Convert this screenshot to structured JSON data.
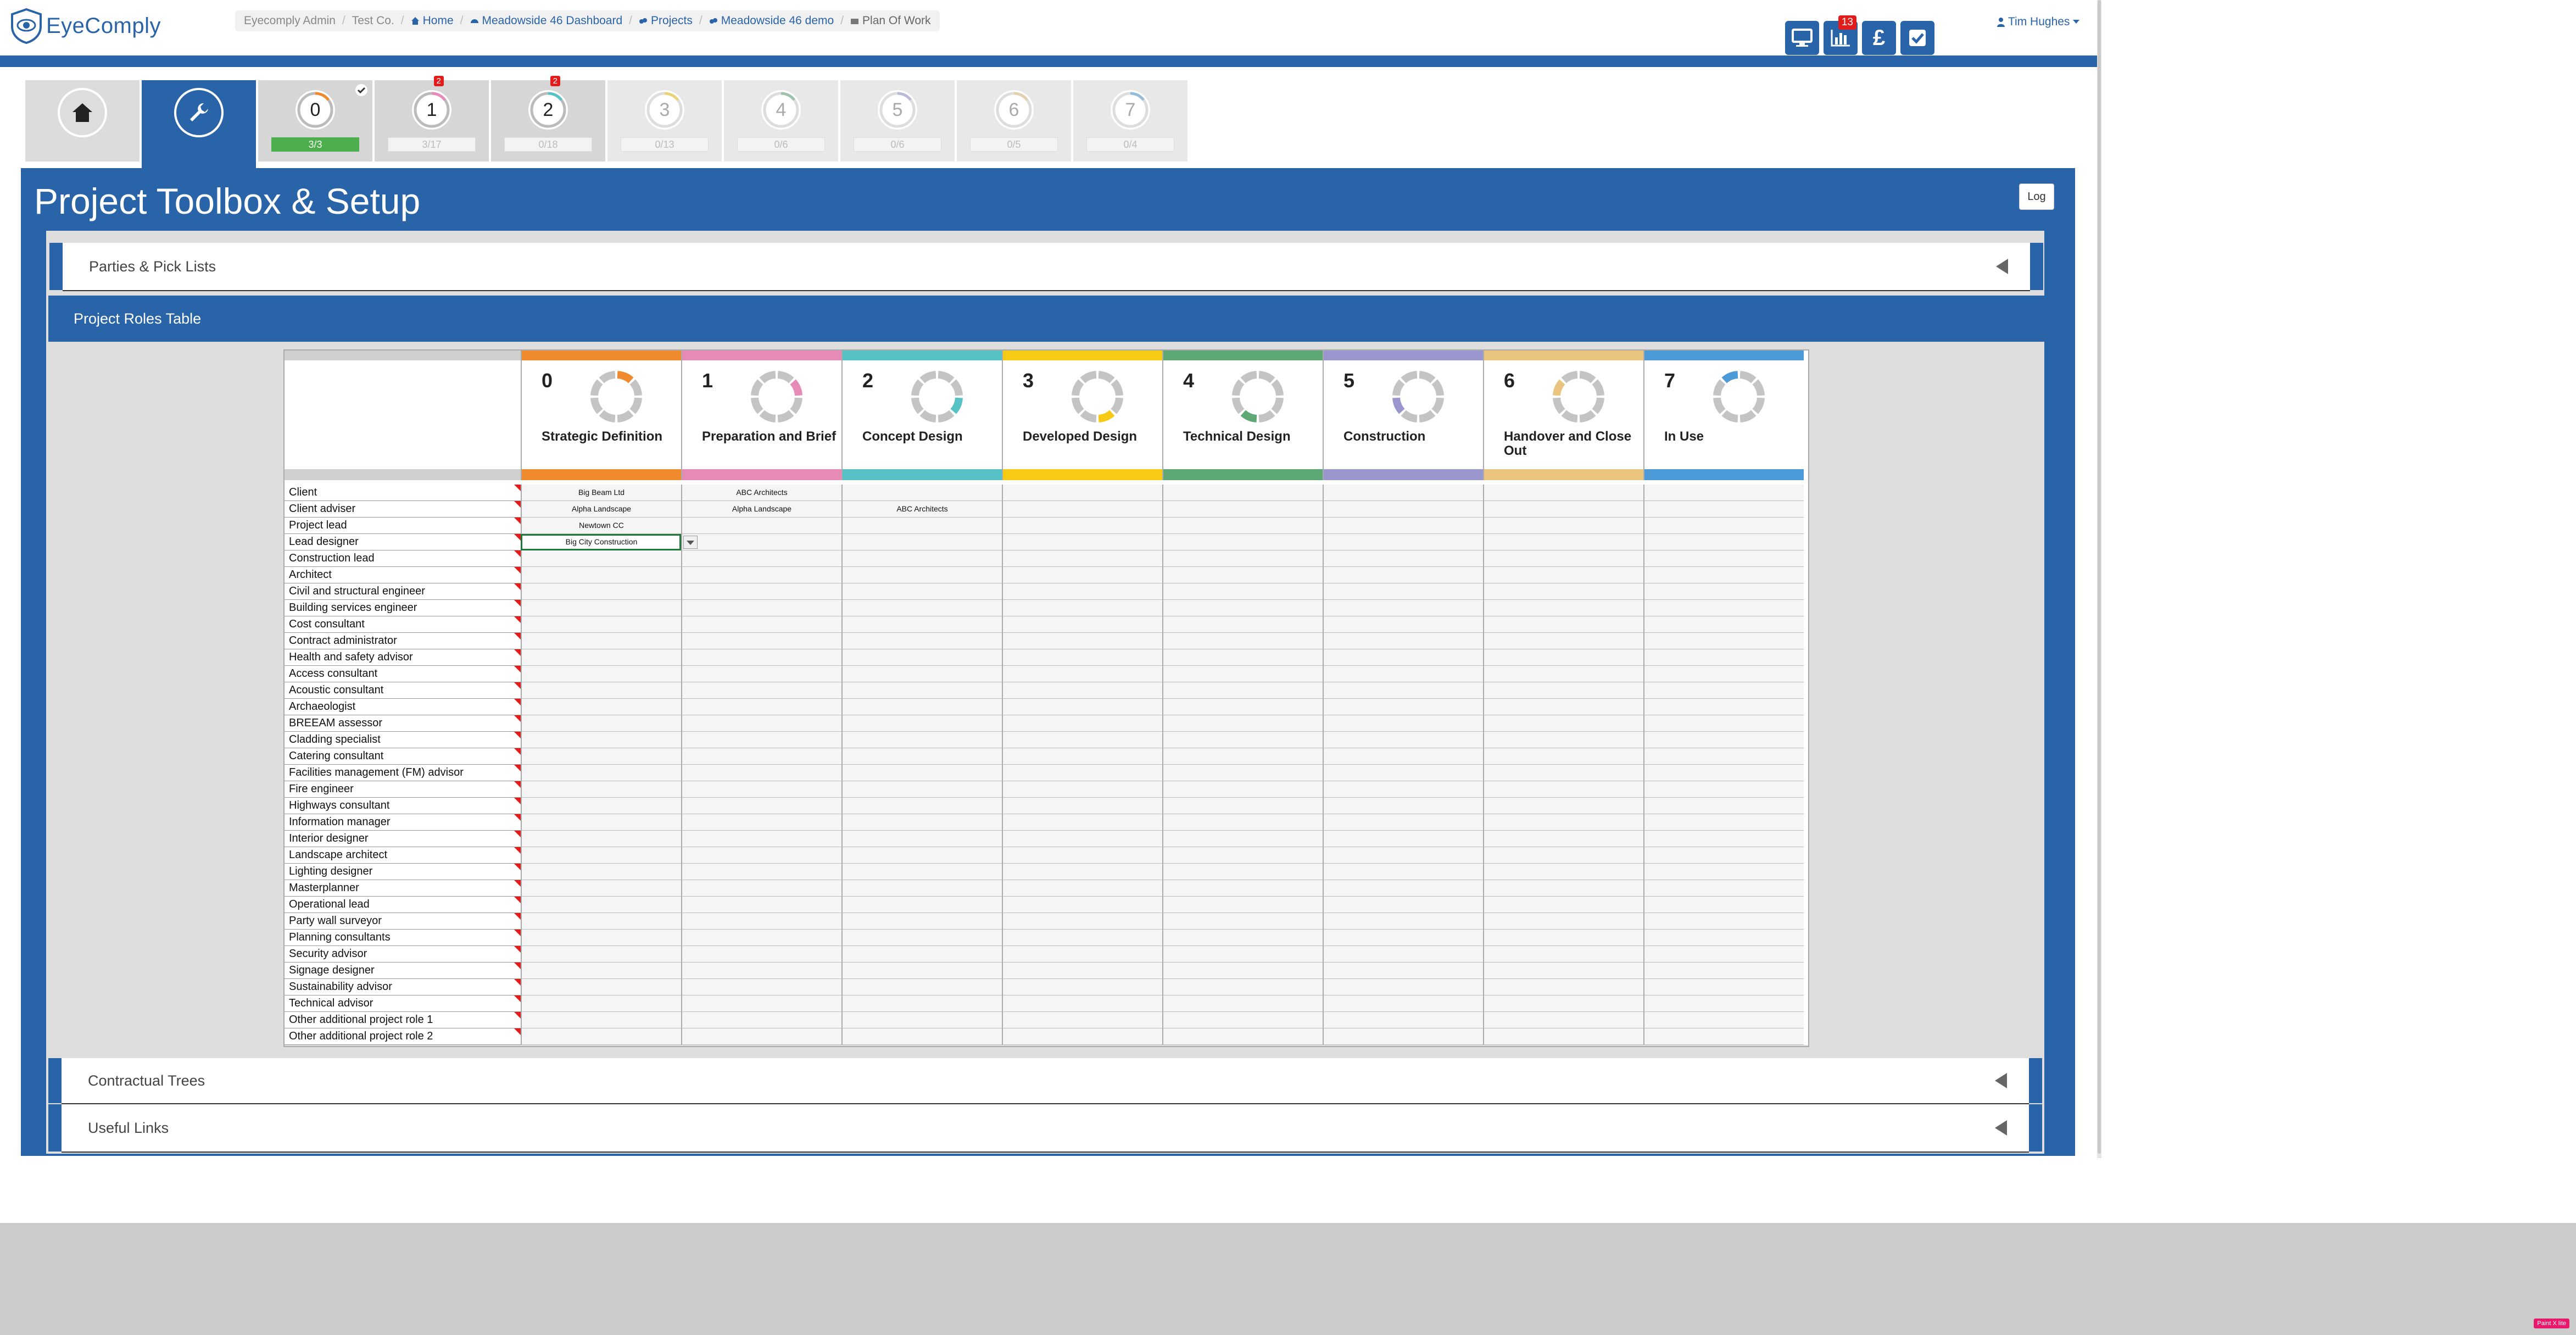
{
  "brand": {
    "name": "EyeComply"
  },
  "breadcrumb": [
    {
      "label": "Eyecomply Admin",
      "link": false
    },
    {
      "label": "Test Co.",
      "link": false
    },
    {
      "label": "Home",
      "link": true,
      "icon": "home-icon"
    },
    {
      "label": "Meadowside 46 Dashboard",
      "link": true,
      "icon": "dashboard-icon"
    },
    {
      "label": "Projects",
      "link": true,
      "icon": "projects-icon"
    },
    {
      "label": "Meadowside 46 demo",
      "link": true,
      "icon": "projects-icon"
    },
    {
      "label": "Plan Of Work",
      "link": false,
      "icon": "briefcase-icon"
    }
  ],
  "header_buttons": [
    {
      "name": "monitor",
      "icon": "monitor-icon",
      "badge": ""
    },
    {
      "name": "reports",
      "icon": "bar-chart-icon",
      "badge": "13"
    },
    {
      "name": "finance",
      "icon": "pound-icon",
      "label": "£",
      "badge": ""
    },
    {
      "name": "tasks",
      "icon": "checkbox-icon",
      "badge": ""
    }
  ],
  "user": {
    "name": "Tim Hughes"
  },
  "stage_tabs": [
    {
      "kind": "home",
      "icon": "home-icon"
    },
    {
      "kind": "setup",
      "icon": "wrench-icon"
    },
    {
      "num": "0",
      "progress": "3/3",
      "complete": true,
      "alert": "",
      "state": "mid"
    },
    {
      "num": "1",
      "progress": "3/17",
      "complete": false,
      "alert": "2",
      "state": "mid"
    },
    {
      "num": "2",
      "progress": "0/18",
      "complete": false,
      "alert": "2",
      "state": "mid"
    },
    {
      "num": "3",
      "progress": "0/13",
      "complete": false,
      "alert": "",
      "state": "faded"
    },
    {
      "num": "4",
      "progress": "0/6",
      "complete": false,
      "alert": "",
      "state": "faded"
    },
    {
      "num": "5",
      "progress": "0/6",
      "complete": false,
      "alert": "",
      "state": "faded"
    },
    {
      "num": "6",
      "progress": "0/5",
      "complete": false,
      "alert": "",
      "state": "faded"
    },
    {
      "num": "7",
      "progress": "0/4",
      "complete": false,
      "alert": "",
      "state": "faded"
    }
  ],
  "page": {
    "title": "Project Toolbox & Setup",
    "log_label": "Log"
  },
  "accordions": {
    "parties": "Parties & Pick Lists",
    "roles": "Project Roles Table",
    "contractual": "Contractual Trees",
    "links": "Useful Links"
  },
  "stages": [
    {
      "num": "0",
      "name": "Strategic Definition",
      "color": "#ef8a2e"
    },
    {
      "num": "1",
      "name": "Preparation and Brief",
      "color": "#e68ab8"
    },
    {
      "num": "2",
      "name": "Concept Design",
      "color": "#56c2c6"
    },
    {
      "num": "3",
      "name": "Developed Design",
      "color": "#f7cb15"
    },
    {
      "num": "4",
      "name": "Technical Design",
      "color": "#5ea876"
    },
    {
      "num": "5",
      "name": "Construction",
      "color": "#9a97cf"
    },
    {
      "num": "6",
      "name": "Handover and Close Out",
      "color": "#e8c47e"
    },
    {
      "num": "7",
      "name": "In Use",
      "color": "#4c9bd6"
    }
  ],
  "roles": [
    {
      "label": "Client",
      "cells": [
        "Big Beam Ltd",
        "ABC Architects",
        "",
        "",
        "",
        "",
        "",
        ""
      ]
    },
    {
      "label": "Client adviser",
      "cells": [
        "Alpha Landscape",
        "Alpha Landscape",
        "ABC Architects",
        "",
        "",
        "",
        "",
        ""
      ]
    },
    {
      "label": "Project lead",
      "cells": [
        "Newtown CC",
        "",
        "",
        "",
        "",
        "",
        "",
        ""
      ]
    },
    {
      "label": "Lead designer",
      "cells": [
        "Big City Construction",
        "",
        "",
        "",
        "",
        "",
        "",
        ""
      ]
    },
    {
      "label": "Construction lead",
      "cells": [
        "",
        "",
        "",
        "",
        "",
        "",
        "",
        ""
      ]
    },
    {
      "label": "Architect",
      "cells": [
        "",
        "",
        "",
        "",
        "",
        "",
        "",
        ""
      ]
    },
    {
      "label": "Civil and structural engineer",
      "cells": [
        "",
        "",
        "",
        "",
        "",
        "",
        "",
        ""
      ]
    },
    {
      "label": "Building services engineer",
      "cells": [
        "",
        "",
        "",
        "",
        "",
        "",
        "",
        ""
      ]
    },
    {
      "label": "Cost consultant",
      "cells": [
        "",
        "",
        "",
        "",
        "",
        "",
        "",
        ""
      ]
    },
    {
      "label": "Contract administrator",
      "cells": [
        "",
        "",
        "",
        "",
        "",
        "",
        "",
        ""
      ]
    },
    {
      "label": "Health and safety advisor",
      "cells": [
        "",
        "",
        "",
        "",
        "",
        "",
        "",
        ""
      ]
    },
    {
      "label": "Access consultant",
      "cells": [
        "",
        "",
        "",
        "",
        "",
        "",
        "",
        ""
      ]
    },
    {
      "label": "Acoustic consultant",
      "cells": [
        "",
        "",
        "",
        "",
        "",
        "",
        "",
        ""
      ]
    },
    {
      "label": "Archaeologist",
      "cells": [
        "",
        "",
        "",
        "",
        "",
        "",
        "",
        ""
      ]
    },
    {
      "label": "BREEAM assessor",
      "cells": [
        "",
        "",
        "",
        "",
        "",
        "",
        "",
        ""
      ]
    },
    {
      "label": "Cladding specialist",
      "cells": [
        "",
        "",
        "",
        "",
        "",
        "",
        "",
        ""
      ]
    },
    {
      "label": "Catering consultant",
      "cells": [
        "",
        "",
        "",
        "",
        "",
        "",
        "",
        ""
      ]
    },
    {
      "label": "Facilities management (FM) advisor",
      "cells": [
        "",
        "",
        "",
        "",
        "",
        "",
        "",
        ""
      ]
    },
    {
      "label": "Fire engineer",
      "cells": [
        "",
        "",
        "",
        "",
        "",
        "",
        "",
        ""
      ]
    },
    {
      "label": "Highways consultant",
      "cells": [
        "",
        "",
        "",
        "",
        "",
        "",
        "",
        ""
      ]
    },
    {
      "label": "Information manager",
      "cells": [
        "",
        "",
        "",
        "",
        "",
        "",
        "",
        ""
      ]
    },
    {
      "label": "Interior designer",
      "cells": [
        "",
        "",
        "",
        "",
        "",
        "",
        "",
        ""
      ]
    },
    {
      "label": "Landscape architect",
      "cells": [
        "",
        "",
        "",
        "",
        "",
        "",
        "",
        ""
      ]
    },
    {
      "label": "Lighting designer",
      "cells": [
        "",
        "",
        "",
        "",
        "",
        "",
        "",
        ""
      ]
    },
    {
      "label": "Masterplanner",
      "cells": [
        "",
        "",
        "",
        "",
        "",
        "",
        "",
        ""
      ]
    },
    {
      "label": "Operational lead",
      "cells": [
        "",
        "",
        "",
        "",
        "",
        "",
        "",
        ""
      ]
    },
    {
      "label": "Party wall surveyor",
      "cells": [
        "",
        "",
        "",
        "",
        "",
        "",
        "",
        ""
      ]
    },
    {
      "label": "Planning consultants",
      "cells": [
        "",
        "",
        "",
        "",
        "",
        "",
        "",
        ""
      ]
    },
    {
      "label": "Security advisor",
      "cells": [
        "",
        "",
        "",
        "",
        "",
        "",
        "",
        ""
      ]
    },
    {
      "label": "Signage designer",
      "cells": [
        "",
        "",
        "",
        "",
        "",
        "",
        "",
        ""
      ]
    },
    {
      "label": "Sustainability advisor",
      "cells": [
        "",
        "",
        "",
        "",
        "",
        "",
        "",
        ""
      ]
    },
    {
      "label": "Technical advisor",
      "cells": [
        "",
        "",
        "",
        "",
        "",
        "",
        "",
        ""
      ]
    },
    {
      "label": "Other additional project role 1",
      "cells": [
        "",
        "",
        "",
        "",
        "",
        "",
        "",
        ""
      ]
    },
    {
      "label": "Other additional project role 2",
      "cells": [
        "",
        "",
        "",
        "",
        "",
        "",
        "",
        ""
      ]
    }
  ],
  "selected_cell": {
    "row": 3,
    "col": 0
  },
  "footer_badge": "Paint X lite"
}
